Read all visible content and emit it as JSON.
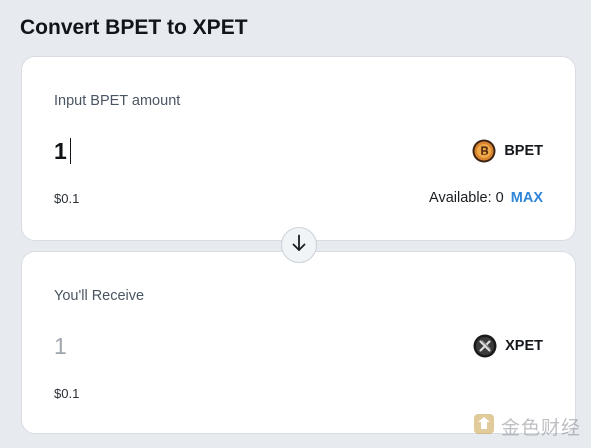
{
  "page_title": "Convert BPET to XPET",
  "pay": {
    "label": "Input BPET amount",
    "amount": "1",
    "usd": "$0.1",
    "token": {
      "symbol": "BPET",
      "icon": "bpet-coin-icon",
      "color": "#c8772a"
    },
    "available_label": "Available: 0",
    "max_label": "MAX"
  },
  "swap": {
    "icon": "arrow-down-icon"
  },
  "receive": {
    "label": "You'll Receive",
    "amount": "1",
    "usd": "$0.1",
    "token": {
      "symbol": "XPET",
      "icon": "xpet-coin-icon",
      "color": "#2a2a2a"
    }
  },
  "watermark": {
    "text": "金色财经",
    "icon": "jinse-logo-icon"
  },
  "colors": {
    "accent": "#2f86d8",
    "background": "#e7eaee",
    "card": "#ffffff"
  }
}
